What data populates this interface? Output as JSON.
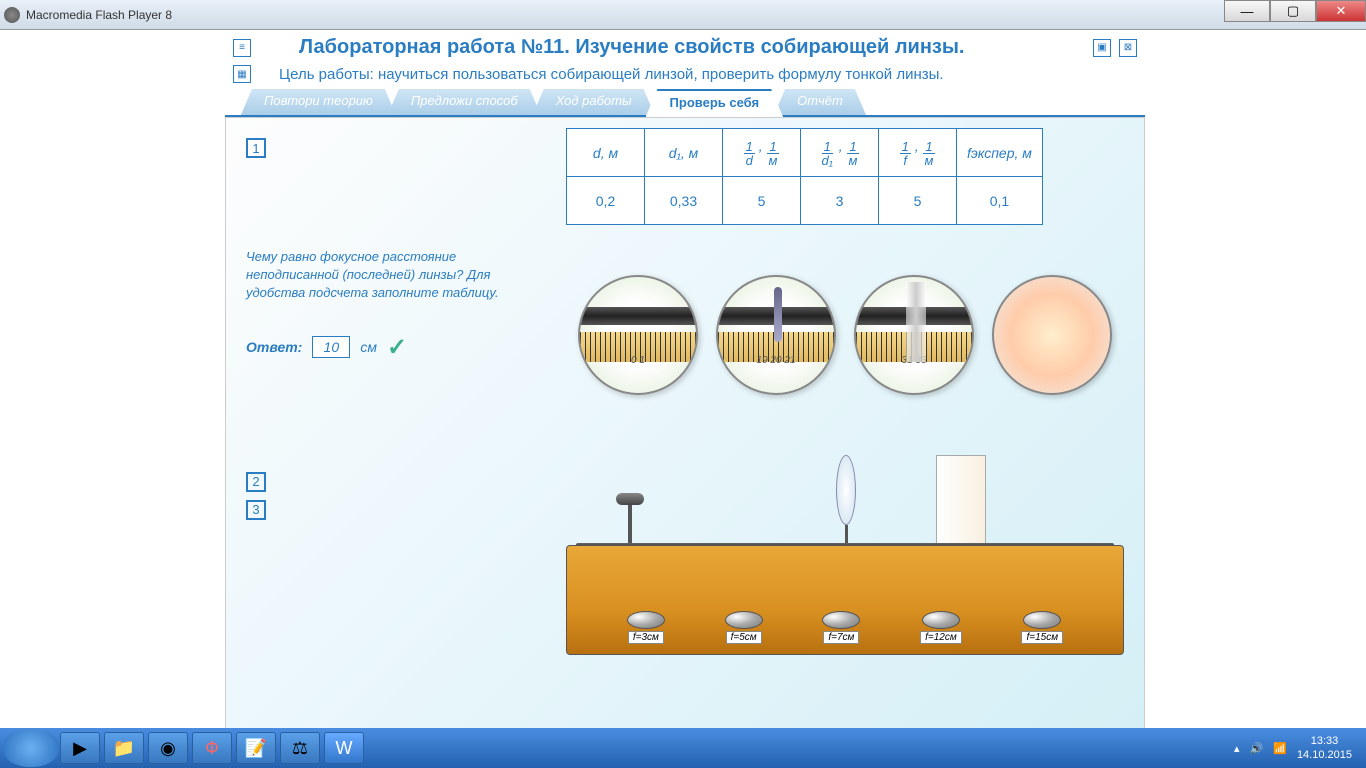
{
  "window_title": "Macromedia Flash Player 8",
  "app": {
    "title": "Лабораторная работа №11.  Изучение свойств собирающей линзы.",
    "subtitle": "Цель работы: научиться пользоваться собирающей линзой, проверить формулу тонкой линзы.",
    "tabs": [
      "Повтори теорию",
      "Предложи способ",
      "Ход работы",
      "Проверь себя",
      "Отчёт"
    ],
    "active_tab": "Проверь себя"
  },
  "question": {
    "number": "1",
    "text": "Чему равно фокусное расстояние неподписанной (последней) линзы? Для удобства подсчета заполните таблицу.",
    "answer_label": "Ответ:",
    "answer_value": "10",
    "answer_unit": "см",
    "other_numbers": [
      "2",
      "3"
    ]
  },
  "table": {
    "headers": [
      "d, м",
      "d₁, м",
      "1/d , 1/м",
      "1/d₁ , 1/м",
      "1/f , 1/м",
      "fэкспер, м"
    ],
    "row": [
      "0,2",
      "0,33",
      "5",
      "3",
      "5",
      "0,1"
    ]
  },
  "magnifiers": [
    "0   1",
    "19  20  21",
    "31    33",
    ""
  ],
  "lens_labels": [
    "f=3см",
    "f=5см",
    "f=7см",
    "f=12см",
    "f=15см"
  ],
  "taskbar": {
    "time": "13:33",
    "date": "14.10.2015"
  }
}
